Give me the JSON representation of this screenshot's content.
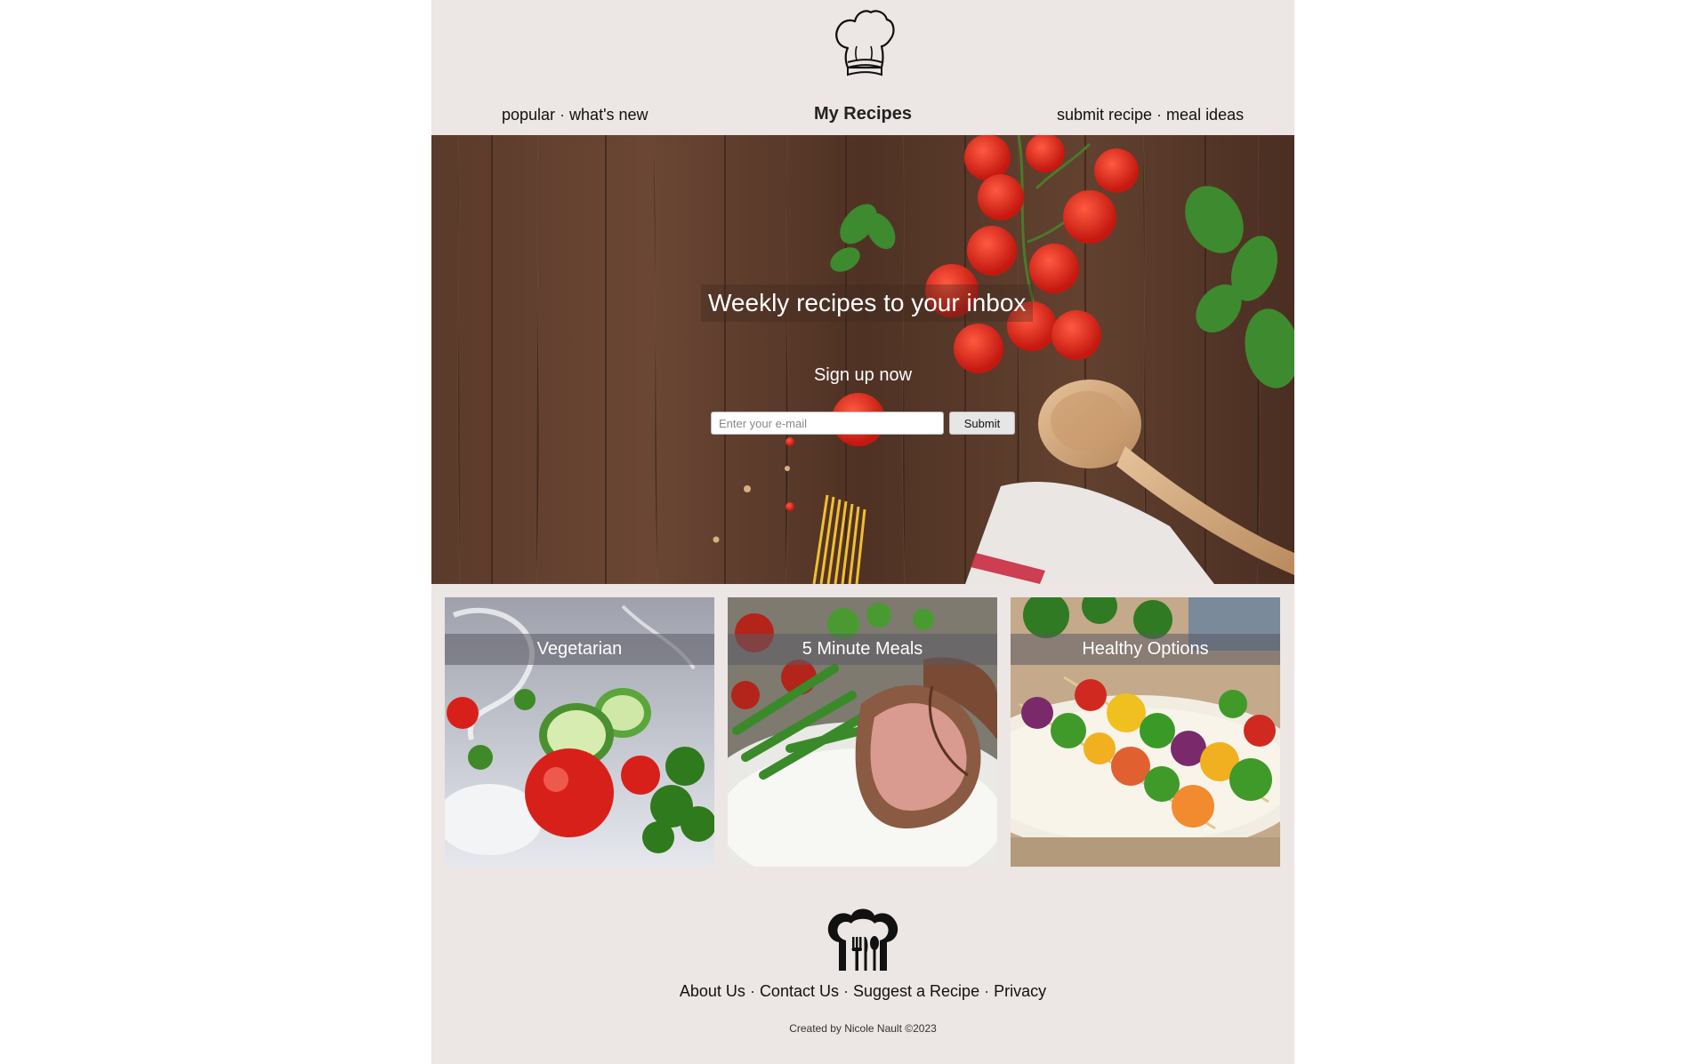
{
  "header": {
    "nav_left": [
      "popular",
      "what's new"
    ],
    "title": "My Recipes",
    "nav_right": [
      "submit recipe",
      "meal ideas"
    ],
    "separator": "·",
    "logo_icon": "chef-hat-icon"
  },
  "hero": {
    "heading": "Weekly recipes to your inbox",
    "subheading": "Sign up now",
    "email_placeholder": "Enter your e-mail",
    "submit_label": "Submit"
  },
  "categories": [
    {
      "label": "Vegetarian"
    },
    {
      "label": "5 Minute Meals"
    },
    {
      "label": "Healthy Options"
    }
  ],
  "footer": {
    "logo_icon": "chef-hat-utensils-icon",
    "links": [
      "About Us",
      "Contact Us",
      "Suggest a Recipe",
      "Privacy"
    ],
    "separator": "·",
    "credit": "Created by Nicole Nault ©2023"
  },
  "colors": {
    "page_background": "#ece6e4",
    "text": "#111111",
    "card_label_overlay": "#5a5a64"
  }
}
